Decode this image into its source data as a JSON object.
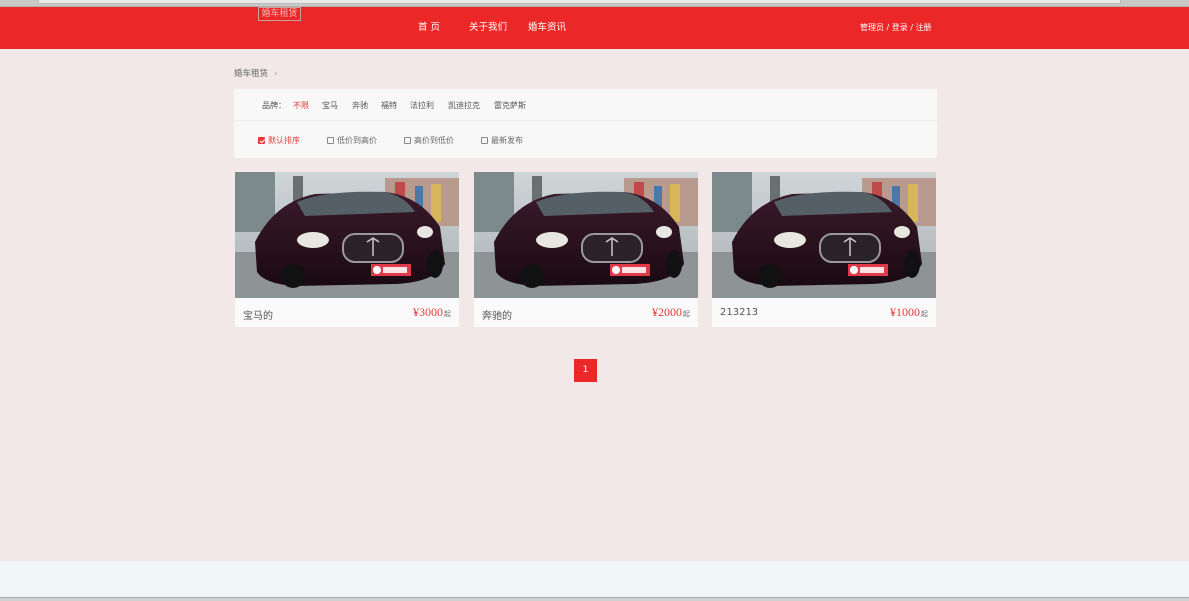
{
  "header": {
    "logo": "婚车租赁",
    "nav": {
      "home": "首 页",
      "about": "关于我们",
      "news": "婚车资讯"
    },
    "user_links": {
      "admin": "管理员",
      "sep1": " / ",
      "login": "登录",
      "sep2": " / ",
      "register": "注册"
    }
  },
  "breadcrumb": {
    "current": "婚车租赁",
    "sep": "›"
  },
  "filter": {
    "brand_label": "品牌：",
    "brands": [
      "不限",
      "宝马",
      "奔驰",
      "福特",
      "法拉利",
      "凯迪拉克",
      "雷克萨斯"
    ],
    "sort_options": [
      "默认排序",
      "低价到高价",
      "高价到低价",
      "最新发布"
    ]
  },
  "cars": [
    {
      "name": "宝马的",
      "price": "¥3000",
      "unit": "起"
    },
    {
      "name": "奔驰的",
      "price": "¥2000",
      "unit": "起"
    },
    {
      "name": "213213",
      "price": "¥1000",
      "unit": "起"
    }
  ],
  "pagination": {
    "current": "1"
  },
  "colors": {
    "brand_red": "#ec2727",
    "page_bg": "#f2e8e8",
    "accent": "#e83a3a"
  }
}
